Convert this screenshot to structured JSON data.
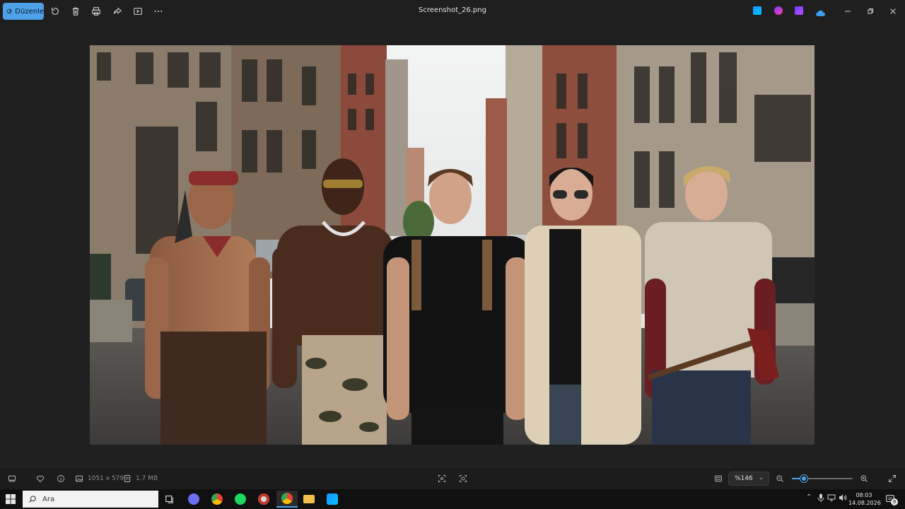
{
  "toolbar": {
    "edit_label": "Düzenle",
    "icons": [
      "edit-icon",
      "rotate-icon",
      "delete-icon",
      "print-icon",
      "share-icon",
      "slideshow-icon",
      "more-icon"
    ]
  },
  "window": {
    "title": "Screenshot_26.png",
    "controls": [
      "minimize-icon",
      "restore-icon",
      "close-icon"
    ]
  },
  "status": {
    "dimensions": "1051 x 579",
    "file_size": "1.7 MB",
    "zoom_value": "%146",
    "zoom_level_fraction": 0.2
  },
  "taskbar": {
    "search_placeholder": "Ara",
    "time": "08:03",
    "date": "14.08.2026",
    "notification_count": "9"
  },
  "colors": {
    "accent": "#4ea1e8",
    "background": "#202020",
    "taskbar": "#101010"
  }
}
